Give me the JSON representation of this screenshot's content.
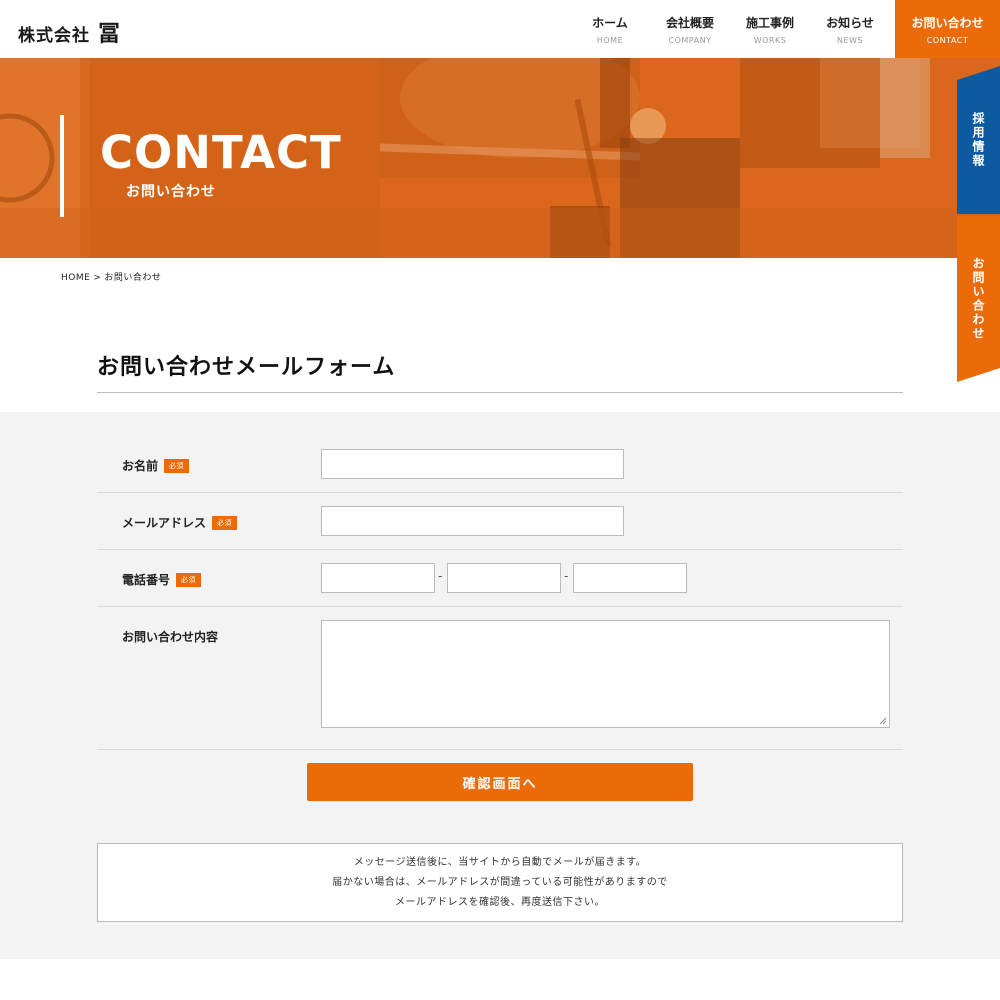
{
  "header": {
    "logo_sub": "株式会社",
    "logo_main": "冨",
    "nav": [
      {
        "ja": "ホーム",
        "en": "HOME"
      },
      {
        "ja": "会社概要",
        "en": "COMPANY"
      },
      {
        "ja": "施工事例",
        "en": "WORKS"
      },
      {
        "ja": "お知らせ",
        "en": "NEWS"
      }
    ],
    "nav_contact": {
      "ja": "お問い合わせ",
      "en": "CONTACT"
    }
  },
  "hero": {
    "title": "CONTACT",
    "subtitle": "お問い合わせ"
  },
  "side_tabs": {
    "recruit": "採用情報",
    "contact": "お問い合わせ"
  },
  "breadcrumb": {
    "home": "HOME",
    "separator": ">",
    "current": "お問い合わせ"
  },
  "page_heading": "お問い合わせメールフォーム",
  "form": {
    "required_badge": "必須",
    "name_label": "お名前",
    "email_label": "メールアドレス",
    "phone_label": "電話番号",
    "phone_separator": "-",
    "message_label": "お問い合わせ内容",
    "submit_label": "確認画面へ"
  },
  "notice": {
    "line1": "メッセージ送信後に、当サイトから自動でメールが届きます。",
    "line2": "届かない場合は、メールアドレスが間違っている可能性がありますので",
    "line3": "メールアドレスを確認後、再度送信下さい。"
  },
  "colors": {
    "accent": "#ec6b09",
    "recruit_blue": "#0d5aa0",
    "form_bg": "#f3f3f3"
  }
}
